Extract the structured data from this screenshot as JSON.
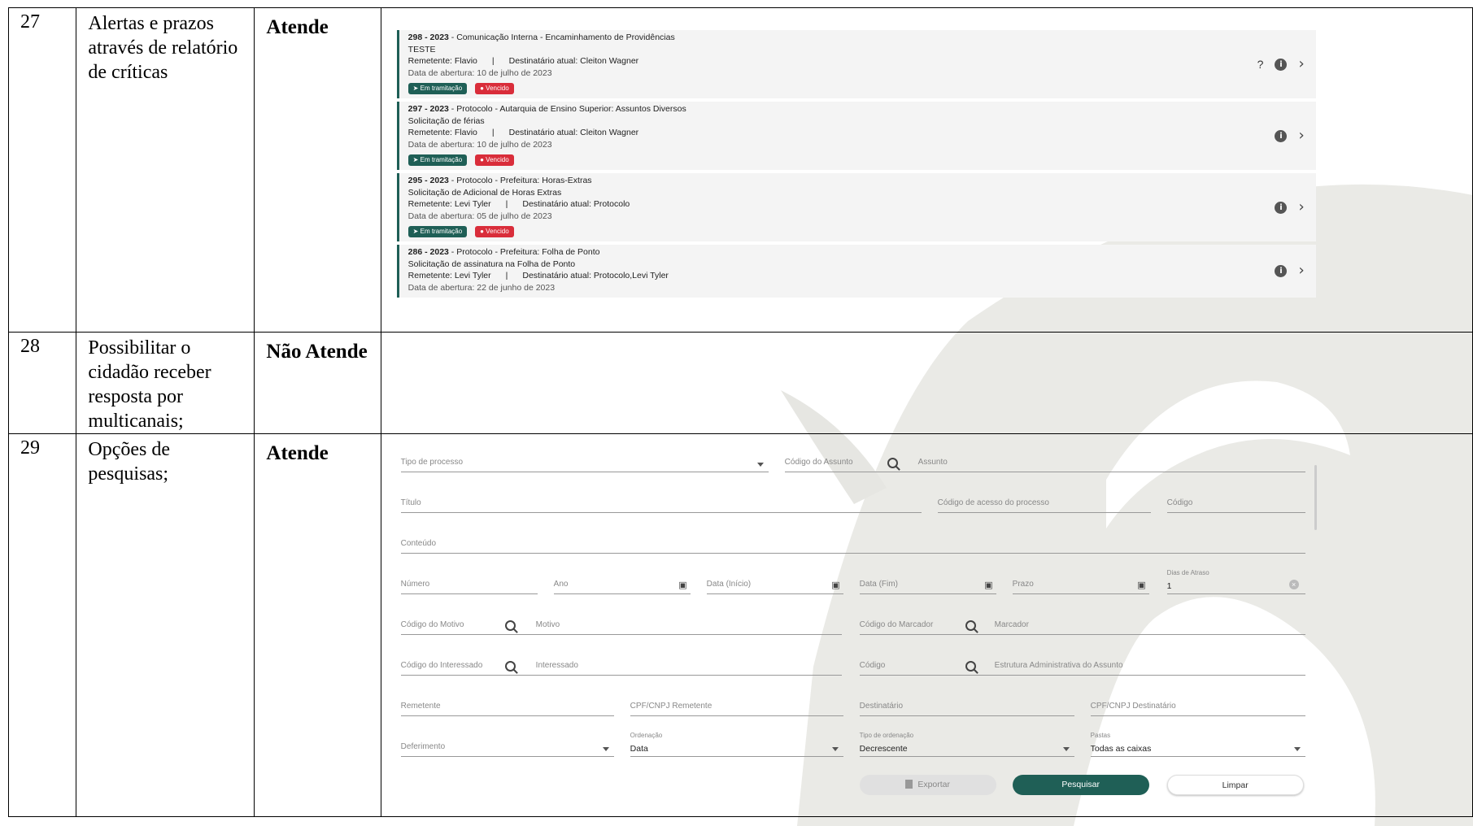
{
  "rows": [
    {
      "num": "27",
      "desc": "Alertas e prazos através de relatório de críticas",
      "status": "Atende"
    },
    {
      "num": "28",
      "desc": "Possibilitar o cidadão receber resposta por multicanais;",
      "status": "Não Atende"
    },
    {
      "num": "29",
      "desc": "Opções de pesquisas;",
      "status": "Atende"
    }
  ],
  "processes": [
    {
      "title_bold": "298 - 2023",
      "title_rest": " - Comunicação Interna - Encaminhamento de Providências",
      "subject": "TESTE",
      "remetente": "Remetente: Flavio",
      "sep": "|",
      "destinatario": "Destinatário atual: Cleiton Wagner",
      "abertura": "Data de abertura: 10 de julho de 2023",
      "badge1": "Em tramitação",
      "badge2": "Vencido",
      "help": "?"
    },
    {
      "title_bold": "297 - 2023",
      "title_rest": " - Protocolo - Autarquia de Ensino Superior: Assuntos Diversos",
      "subject": "Solicitação de férias",
      "remetente": "Remetente: Flavio",
      "sep": "|",
      "destinatario": "Destinatário atual: Cleiton Wagner",
      "abertura": "Data de abertura: 10 de julho de 2023",
      "badge1": "Em tramitação",
      "badge2": "Vencido"
    },
    {
      "title_bold": "295 - 2023",
      "title_rest": " - Protocolo - Prefeitura: Horas-Extras",
      "subject": "Solicitação de Adicional de Horas Extras",
      "remetente": "Remetente: Levi Tyler",
      "sep": "|",
      "destinatario": "Destinatário atual: Protocolo",
      "abertura": "Data de abertura: 05 de julho de 2023",
      "badge1": "Em tramitação",
      "badge2": "Vencido"
    },
    {
      "title_bold": "286 - 2023",
      "title_rest": " - Protocolo - Prefeitura: Folha de Ponto",
      "subject": "Solicitação de assinatura na Folha de Ponto",
      "remetente": "Remetente: Levi Tyler",
      "sep": "|",
      "destinatario": "Destinatário atual: Protocolo,Levi Tyler",
      "abertura": "Data de abertura: 22 de junho de 2023"
    }
  ],
  "form": {
    "tipo_processo": "Tipo de processo",
    "codigo_assunto": "Código do Assunto",
    "assunto": "Assunto",
    "titulo": "Título",
    "codigo_acesso": "Código de acesso do processo",
    "codigo": "Código",
    "conteudo": "Conteúdo",
    "numero": "Número",
    "ano": "Ano",
    "data_inicio": "Data (Início)",
    "data_fim": "Data (Fim)",
    "prazo": "Prazo",
    "dias_atraso_label": "Dias de Atraso",
    "dias_atraso_value": "1",
    "codigo_motivo": "Código do Motivo",
    "motivo": "Motivo",
    "codigo_marcador": "Código do Marcador",
    "marcador": "Marcador",
    "codigo_interessado": "Código do Interessado",
    "interessado": "Interessado",
    "codigo2": "Código",
    "estrutura": "Estrutura Administrativa do Assunto",
    "remetente": "Remetente",
    "cpf_remetente": "CPF/CNPJ Remetente",
    "destinatario": "Destinatário",
    "cpf_destinatario": "CPF/CNPJ Destinatário",
    "deferimento": "Deferimento",
    "ordenacao_label": "Ordenação",
    "ordenacao_value": "Data",
    "tipo_ordenacao_label": "Tipo de ordenação",
    "tipo_ordenacao_value": "Decrescente",
    "pastas_label": "Pastas",
    "pastas_value": "Todas as caixas",
    "btn_exportar": "Exportar",
    "btn_pesquisar": "Pesquisar",
    "btn_limpar": "Limpar"
  },
  "colors": {
    "primary": "#1f5f56",
    "danger": "#d92d3a",
    "watermark": "#eaeae6"
  }
}
